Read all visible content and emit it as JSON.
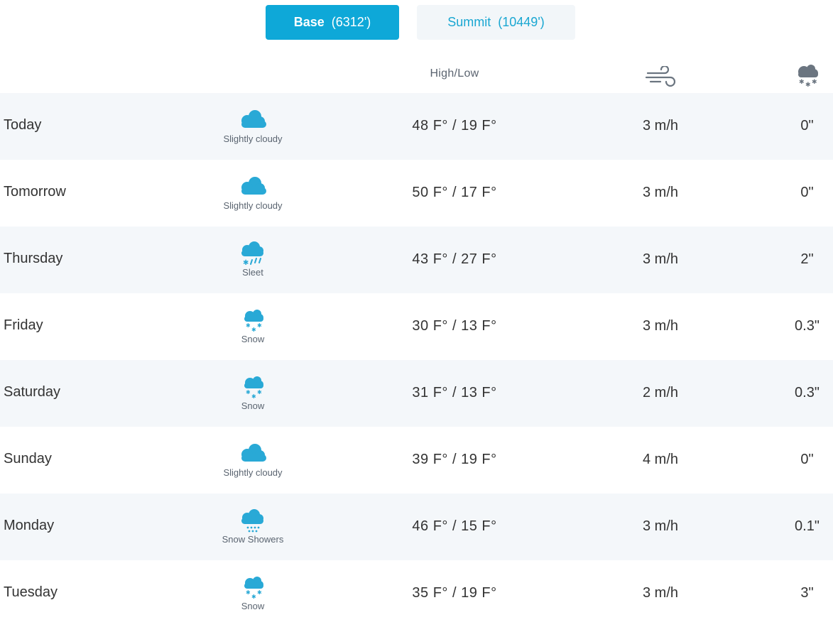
{
  "toggle": {
    "base": {
      "label": "Base",
      "elevation": "(6312')"
    },
    "summit": {
      "label": "Summit",
      "elevation": "(10449')"
    }
  },
  "header": {
    "highlow": "High/Low",
    "wind_icon": "wind-icon",
    "snow_icon": "snow-cloud-icon"
  },
  "colors": {
    "accent": "#0ea8d8",
    "icon": "#29a9d6",
    "stripe": "#f4f7fa"
  },
  "forecast": [
    {
      "day": "Today",
      "icon": "cloud",
      "condition": "Slightly cloudy",
      "temp": "48 F° / 19 F°",
      "wind": "3 m/h",
      "snow": "0\""
    },
    {
      "day": "Tomorrow",
      "icon": "cloud",
      "condition": "Slightly cloudy",
      "temp": "50 F° / 17 F°",
      "wind": "3 m/h",
      "snow": "0\""
    },
    {
      "day": "Thursday",
      "icon": "sleet",
      "condition": "Sleet",
      "temp": "43 F° / 27 F°",
      "wind": "3 m/h",
      "snow": "2\""
    },
    {
      "day": "Friday",
      "icon": "snow",
      "condition": "Snow",
      "temp": "30 F° / 13 F°",
      "wind": "3 m/h",
      "snow": "0.3\""
    },
    {
      "day": "Saturday",
      "icon": "snow",
      "condition": "Snow",
      "temp": "31 F° / 13 F°",
      "wind": "2 m/h",
      "snow": "0.3\""
    },
    {
      "day": "Sunday",
      "icon": "cloud",
      "condition": "Slightly cloudy",
      "temp": "39 F° / 19 F°",
      "wind": "4 m/h",
      "snow": "0\""
    },
    {
      "day": "Monday",
      "icon": "snow-showers",
      "condition": "Snow Showers",
      "temp": "46 F° / 15 F°",
      "wind": "3 m/h",
      "snow": "0.1\""
    },
    {
      "day": "Tuesday",
      "icon": "snow",
      "condition": "Snow",
      "temp": "35 F° / 19 F°",
      "wind": "3 m/h",
      "snow": "3\""
    }
  ]
}
